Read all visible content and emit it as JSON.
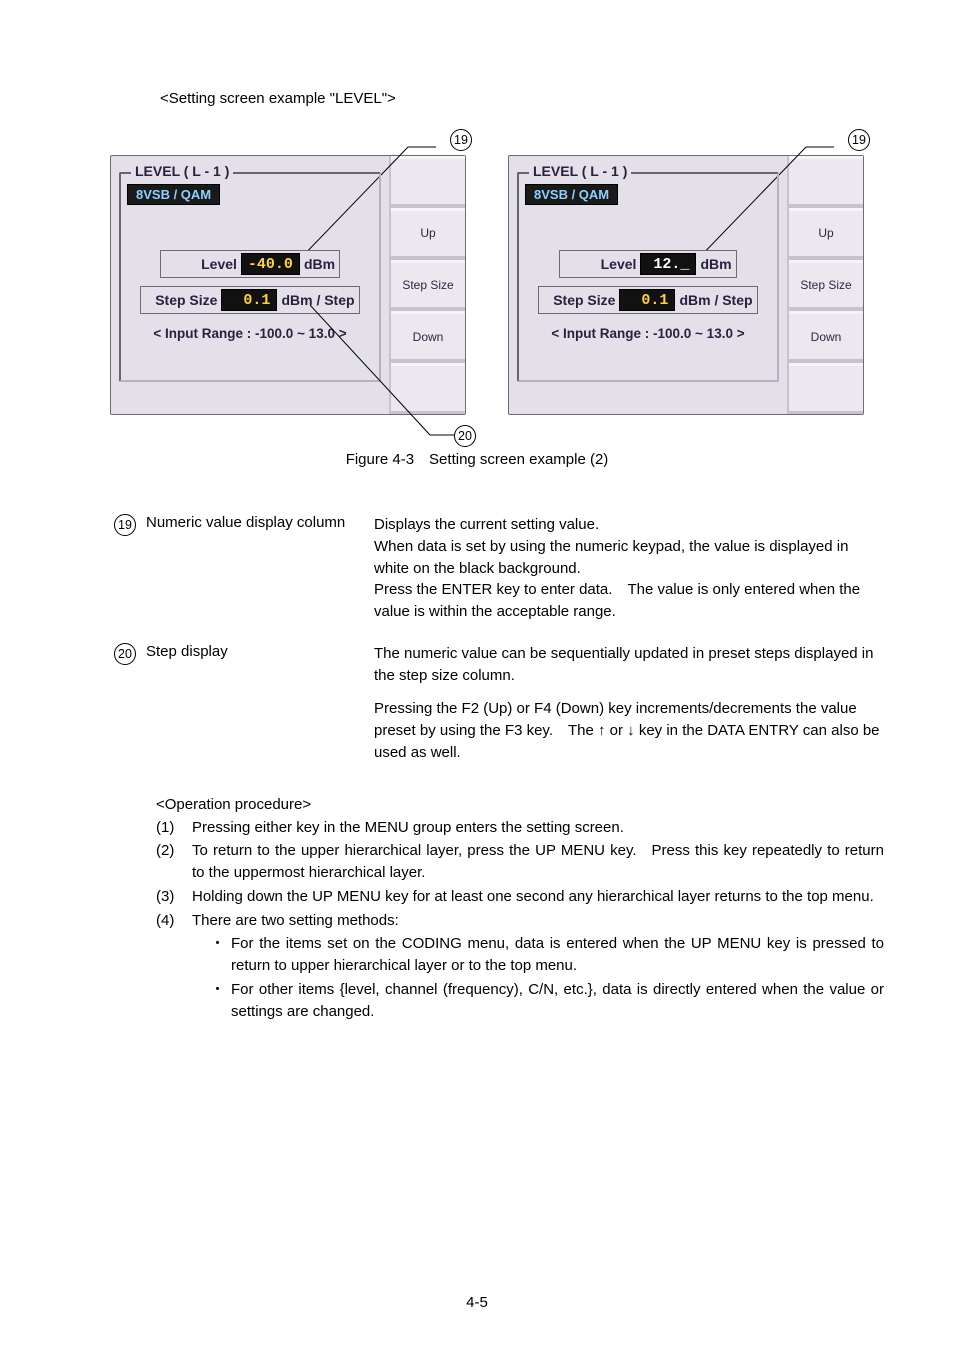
{
  "heading": "<Setting screen example \"LEVEL\">",
  "callouts": {
    "n19": "19",
    "n20": "20"
  },
  "panelLeft": {
    "groupTitle": "LEVEL ( L - 1 )",
    "modeChip": "8VSB / QAM",
    "labels": {
      "level": "Level",
      "step": "Step Size"
    },
    "values": {
      "level": "-40.0",
      "step": "0.1"
    },
    "units": {
      "level": "dBm",
      "step": "dBm / Step"
    },
    "range": "< Input Range : -100.0 ~ 13.0 >",
    "soft": {
      "up": "Up",
      "stepSize": "Step Size",
      "down": "Down"
    }
  },
  "panelRight": {
    "groupTitle": "LEVEL ( L - 1 )",
    "modeChip": "8VSB / QAM",
    "labels": {
      "level": "Level",
      "step": "Step Size"
    },
    "values": {
      "level": "12._",
      "step": "0.1"
    },
    "units": {
      "level": "dBm",
      "step": "dBm / Step"
    },
    "range": "< Input Range : -100.0 ~ 13.0 >",
    "soft": {
      "up": "Up",
      "stepSize": "Step Size",
      "down": "Down"
    }
  },
  "figureCaption": "Figure 4-3 Setting screen example (2)",
  "defs": {
    "d19": {
      "num": "19",
      "term": "Numeric value display column",
      "body1": "Displays the current setting value.",
      "body2": "When data is set by using the numeric keypad, the value is displayed in white on the black background.",
      "body3": "Press the ENTER key to enter data. The value is only entered when the value is within the acceptable range."
    },
    "d20": {
      "num": "20",
      "term": "Step display",
      "body1": "The numeric value can be sequentially updated in preset steps displayed in the step size column.",
      "body2": "Pressing the F2 (Up) or F4 (Down) key increments/decrements the value preset by using the F3 key. The ↑ or ↓ key in the DATA ENTRY can also be used as well."
    }
  },
  "op": {
    "head": "<Operation procedure>",
    "items": [
      {
        "n": "(1)",
        "t": "Pressing either key in the MENU group enters the setting screen."
      },
      {
        "n": "(2)",
        "t": "To return to the upper hierarchical layer, press the UP MENU key. Press this key repeatedly to return to the uppermost hierarchical layer."
      },
      {
        "n": "(3)",
        "t": "Holding down the UP MENU key for at least one second any hierarchical layer returns to the top menu."
      },
      {
        "n": "(4)",
        "t": "There are two setting methods:"
      }
    ],
    "subs": [
      "For the items set on the CODING menu, data is entered when the UP MENU key is pressed to return to upper hierarchical layer or to the top menu.",
      "For other items {level, channel (frequency), C/N, etc.}, data is directly entered when the value or settings are changed."
    ]
  },
  "pageNumber": "4-5"
}
